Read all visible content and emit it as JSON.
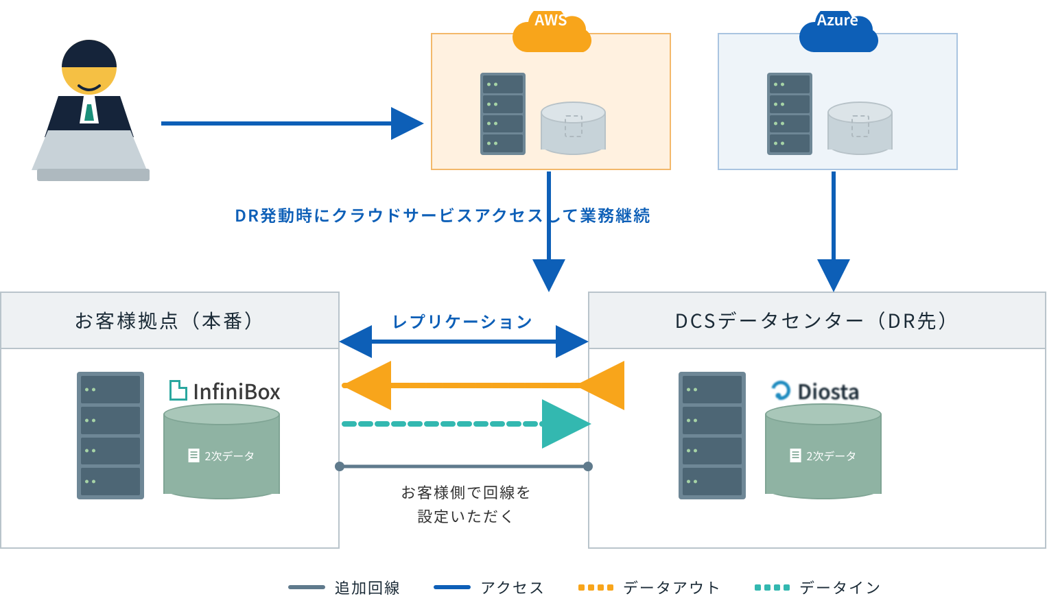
{
  "clouds": {
    "aws": {
      "label": "AWS"
    },
    "azure": {
      "label": "Azure"
    }
  },
  "annotation_top": "DR発動時にクラウドサービスアクセスして業務継続",
  "boxes": {
    "customer": {
      "title": "お客様拠点（本番）",
      "product_logo_text": "InfiniBox",
      "disk_label": "2次データ"
    },
    "dcs": {
      "title": "DCSデータセンター（DR先）",
      "product_logo_text": "Diosta",
      "disk_label": "2次データ"
    }
  },
  "center_labels": {
    "replication": "レプリケーション",
    "line_setup_l1": "お客様側で回線を",
    "line_setup_l2": "設定いただく"
  },
  "legend": {
    "extra_line": "追加回線",
    "access": "アクセス",
    "data_out": "データアウト",
    "data_in": "データイン"
  },
  "icons": {
    "user": "user-laptop-icon",
    "cloud_aws": "cloud-icon",
    "cloud_azure": "cloud-icon",
    "server": "server-rack-icon",
    "database": "database-cylinder-icon"
  }
}
